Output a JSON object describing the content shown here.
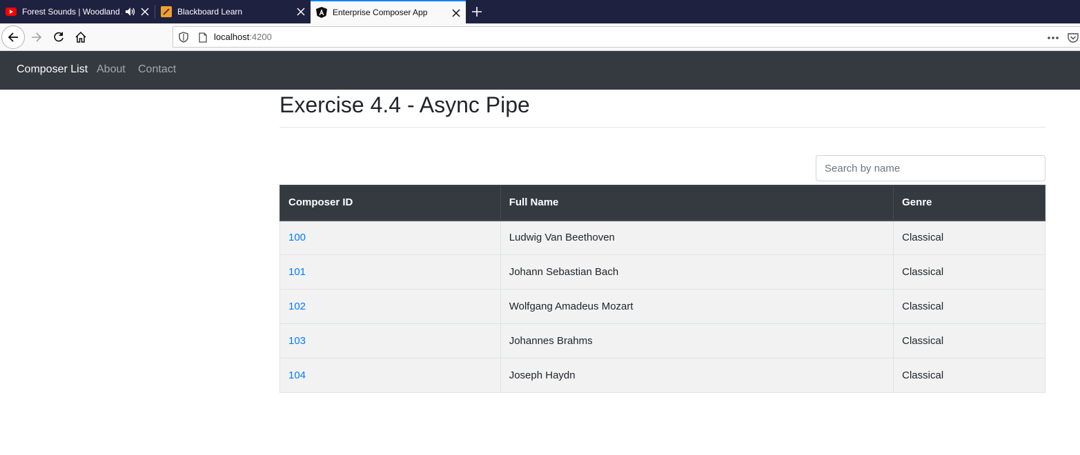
{
  "browser": {
    "tabs": [
      {
        "title": "Forest Sounds | Woodland Ambience",
        "icon": "youtube-icon",
        "active": false,
        "audio": true
      },
      {
        "title": "Blackboard Learn",
        "icon": "blackboard-icon",
        "active": false,
        "audio": false
      },
      {
        "title": "Enterprise Composer App",
        "icon": "angular-icon",
        "active": true,
        "audio": false
      }
    ],
    "url": {
      "host": "localhost",
      "port": ":4200"
    }
  },
  "app_nav": {
    "brand": "Composer List",
    "links": [
      "About",
      "Contact"
    ]
  },
  "main": {
    "title": "Exercise 4.4 - Async Pipe",
    "search": {
      "placeholder": "Search by name",
      "value": ""
    },
    "table": {
      "headers": [
        "Composer ID",
        "Full Name",
        "Genre"
      ],
      "rows": [
        {
          "id": "100",
          "name": "Ludwig Van Beethoven",
          "genre": "Classical"
        },
        {
          "id": "101",
          "name": "Johann Sebastian Bach",
          "genre": "Classical"
        },
        {
          "id": "102",
          "name": "Wolfgang Amadeus Mozart",
          "genre": "Classical"
        },
        {
          "id": "103",
          "name": "Johannes Brahms",
          "genre": "Classical"
        },
        {
          "id": "104",
          "name": "Joseph Haydn",
          "genre": "Classical"
        }
      ]
    }
  },
  "colors": {
    "tabstrip": "#1f2140",
    "active_tab_accent": "#0a84ff",
    "app_navbar": "#343a40",
    "link": "#007bff",
    "row_background": "#f2f2f2"
  }
}
